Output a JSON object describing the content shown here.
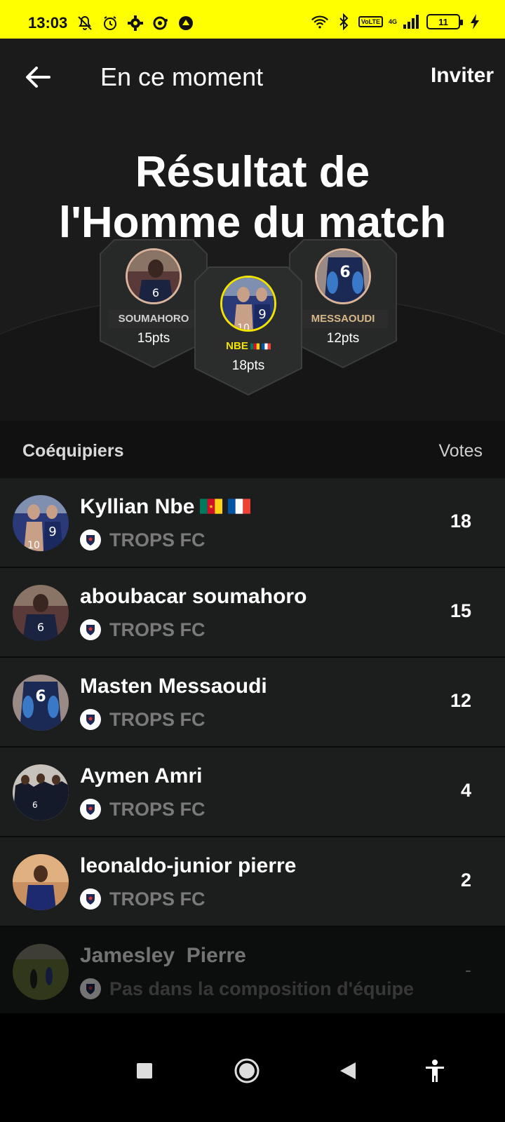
{
  "status_bar": {
    "time": "13:03",
    "battery": "11",
    "network": "4G",
    "volte": "VoLTE",
    "bg_color": "#ffff00"
  },
  "header": {
    "back_icon": "arrow-left-icon",
    "title": "En ce moment",
    "invite_label": "Inviter"
  },
  "hero": {
    "title_line1": "Résultat de",
    "title_line2": "l'Homme du match"
  },
  "podium": {
    "second": {
      "name": "SOUMAHORO",
      "points": "15pts"
    },
    "first": {
      "name": "NBE",
      "points": "18pts",
      "accent": "#f2e300"
    },
    "third": {
      "name": "MESSAOUDI",
      "points": "12pts"
    }
  },
  "list_header": {
    "left": "Coéquipiers",
    "right": "Votes"
  },
  "players": [
    {
      "name": "Kyllian Nbe",
      "team": "TROPS FC",
      "votes": "18",
      "flags": [
        "cameroon-flag-icon",
        "france-flag-icon"
      ]
    },
    {
      "name": "aboubacar soumahoro",
      "team": "TROPS FC",
      "votes": "15"
    },
    {
      "name": "Masten Messaoudi",
      "team": "TROPS FC",
      "votes": "12"
    },
    {
      "name": "Aymen Amri",
      "team": "TROPS FC",
      "votes": "4"
    },
    {
      "name": "leonaldo-junior pierre",
      "team": "TROPS FC",
      "votes": "2"
    },
    {
      "name": "Jamesley  Pierre",
      "team": "Pas dans la composition d'équipe",
      "votes": "-"
    }
  ],
  "nav": {
    "icons": [
      "square-icon",
      "home-circle-icon",
      "back-triangle-icon",
      "accessibility-icon"
    ]
  }
}
